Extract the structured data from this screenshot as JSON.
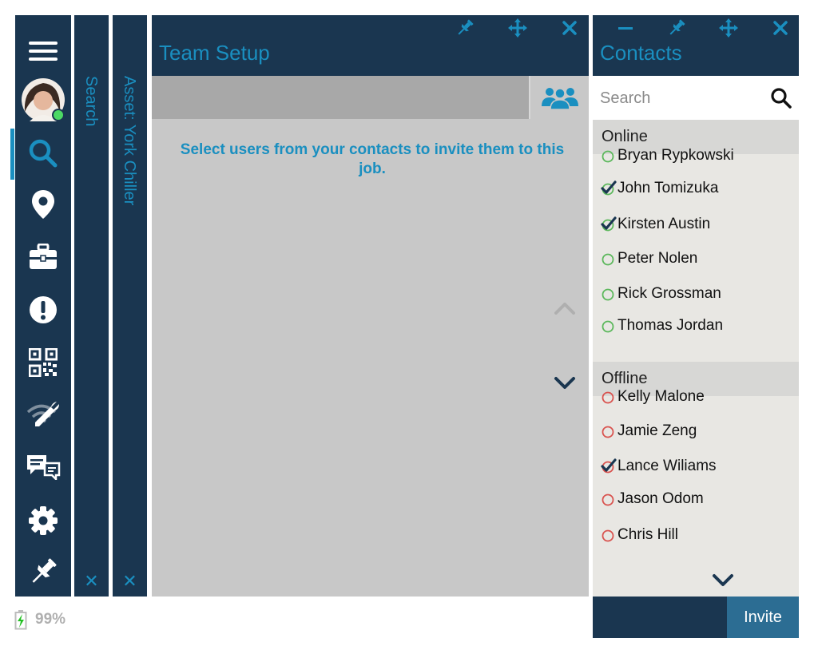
{
  "nav": {
    "icons": [
      "menu-icon",
      "avatar",
      "search-icon",
      "location-pin-icon",
      "toolbox-icon",
      "alert-icon",
      "qr-code-icon",
      "wifi-wrench-icon",
      "chat-icon",
      "gear-icon",
      "pin-icon"
    ],
    "active": "search-icon",
    "presence_color": "#4cd964"
  },
  "collapsed_panels": [
    {
      "label": "Search",
      "close": "✕"
    },
    {
      "label": "Asset: York Chiller",
      "close": "✕"
    }
  ],
  "team_setup": {
    "title": "Team Setup",
    "message": "Select users from your contacts to invite them to this job."
  },
  "contacts": {
    "title": "Contacts",
    "search_placeholder": "Search",
    "sections": [
      {
        "label": "Online",
        "people": [
          {
            "name": "Bryan Rypkowski",
            "checked": false
          },
          {
            "name": "John Tomizuka",
            "checked": true
          },
          {
            "name": "Kirsten Austin",
            "checked": true
          },
          {
            "name": "Peter Nolen",
            "checked": false
          },
          {
            "name": "Rick Grossman",
            "checked": false
          },
          {
            "name": "Thomas Jordan",
            "checked": false
          }
        ]
      },
      {
        "label": "Offline",
        "people": [
          {
            "name": "Kelly Malone",
            "checked": false
          },
          {
            "name": "Jamie Zeng",
            "checked": false
          },
          {
            "name": "Lance Wiliams",
            "checked": true
          },
          {
            "name": "Jason Odom",
            "checked": false
          },
          {
            "name": "Chris Hill",
            "checked": false
          }
        ]
      }
    ],
    "invite_label": "Invite"
  },
  "battery": {
    "percent": "99%"
  },
  "colors": {
    "navy": "#1a3650",
    "accent": "#1a8fc0",
    "online": "#5cb85c",
    "offline": "#d9534f",
    "check": "#1a3650",
    "invite_bg": "#2c6d93"
  }
}
